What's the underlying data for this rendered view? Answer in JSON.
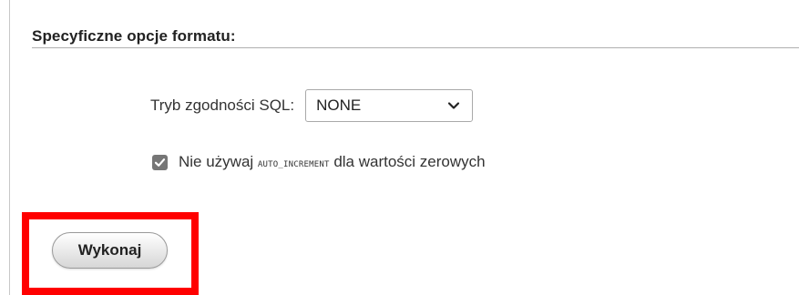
{
  "format_options": {
    "title": "Specyficzne opcje formatu:"
  },
  "sql_mode": {
    "label": "Tryb zgodności SQL:",
    "selected": "NONE"
  },
  "auto_increment_option": {
    "checked": true,
    "label_before": "Nie używaj ",
    "keyword": "AUTO_INCREMENT",
    "label_after": " dla wartości zerowych"
  },
  "actions": {
    "run_label": "Wykonaj"
  },
  "colors": {
    "highlight": "#ff0000",
    "checkbox_fill": "#767676"
  },
  "icons": {
    "select_arrow": "chevron-down-icon",
    "checkbox_mark": "checkmark-icon"
  }
}
